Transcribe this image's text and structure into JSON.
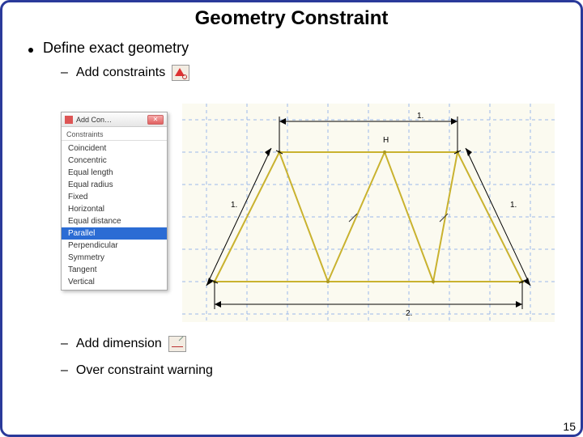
{
  "title": "Geometry Constraint",
  "bullets": {
    "main": "Define exact geometry",
    "sub1": "Add constraints",
    "sub2": "Add dimension",
    "sub3": "Over constraint warning"
  },
  "dialog": {
    "title": "Add Con…",
    "close": "✕",
    "section": "Constraints",
    "items": [
      {
        "label": "Coincident",
        "sel": false
      },
      {
        "label": "Concentric",
        "sel": false
      },
      {
        "label": "Equal length",
        "sel": false
      },
      {
        "label": "Equal radius",
        "sel": false
      },
      {
        "label": "Fixed",
        "sel": false
      },
      {
        "label": "Horizontal",
        "sel": false
      },
      {
        "label": "Equal distance",
        "sel": false
      },
      {
        "label": "Parallel",
        "sel": true
      },
      {
        "label": "Perpendicular",
        "sel": false
      },
      {
        "label": "Symmetry",
        "sel": false
      },
      {
        "label": "Tangent",
        "sel": false
      },
      {
        "label": "Vertical",
        "sel": false
      }
    ]
  },
  "sketch": {
    "dim_top": "1.",
    "dim_bottom": "2.",
    "dim_left": "1.",
    "dim_right": "1.",
    "h_label": "H"
  },
  "page_number": "15"
}
